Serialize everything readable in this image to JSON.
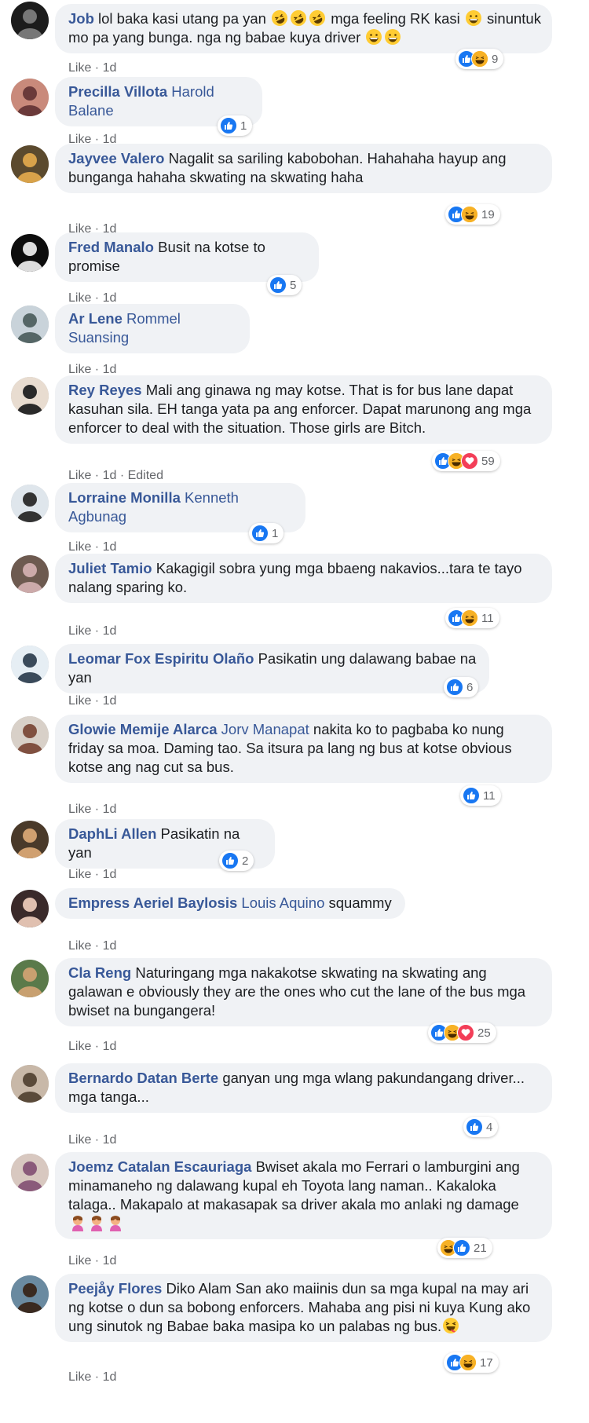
{
  "comments": [
    {
      "author": "Job",
      "mention": "",
      "text": "lol baka kasi utang pa yan",
      "emoji_after": [
        "rofl",
        "rofl",
        "rofl"
      ],
      "text2": " mga feeling RK kasi ",
      "emoji_after2": [
        "grin"
      ],
      "text3": " sinuntuk mo pa yang bunga. nga ng babae kuya driver ",
      "emoji_after3": [
        "smile",
        "grin"
      ],
      "like": "Like",
      "time": "1d",
      "edited": "",
      "reactions": [
        "like",
        "haha"
      ],
      "count": "9"
    },
    {
      "author": "Precilla Villota",
      "mention": "Harold Balane",
      "text": "",
      "like": "Like",
      "time": "1d",
      "edited": "",
      "reactions": [
        "like"
      ],
      "count": "1"
    },
    {
      "author": "Jayvee Valero",
      "mention": "",
      "text": "Nagalit sa sariling kabobohan. Hahahaha hayup ang bunganga hahaha skwating na skwating haha",
      "like": "Like",
      "time": "1d",
      "edited": "",
      "reactions": [
        "like",
        "haha"
      ],
      "count": "19"
    },
    {
      "author": "Fred Manalo",
      "mention": "",
      "text": "Busit na kotse to promise",
      "like": "Like",
      "time": "1d",
      "edited": "",
      "reactions": [
        "like"
      ],
      "count": "5"
    },
    {
      "author": "Ar Lene",
      "mention": "Rommel Suansing",
      "text": "",
      "like": "Like",
      "time": "1d",
      "edited": "",
      "reactions": [],
      "count": ""
    },
    {
      "author": "Rey Reyes",
      "mention": "",
      "text": "Mali ang ginawa ng may kotse. That is for bus lane dapat kasuhan sila. EH tanga yata pa ang enforcer. Dapat marunong ang mga enforcer to deal with the situation. Those girls are Bitch.",
      "like": "Like",
      "time": "1d",
      "edited": "Edited",
      "reactions": [
        "like",
        "haha",
        "love"
      ],
      "count": "59"
    },
    {
      "author": "Lorraine Monilla",
      "mention": "Kenneth Agbunag",
      "text": "",
      "like": "Like",
      "time": "1d",
      "edited": "",
      "reactions": [
        "like"
      ],
      "count": "1"
    },
    {
      "author": "Juliet Tamio",
      "mention": "",
      "text": "Kakagigil sobra yung mga bbaeng nakavios...tara te tayo nalang sparing ko.",
      "like": "Like",
      "time": "1d",
      "edited": "",
      "reactions": [
        "like",
        "haha"
      ],
      "count": "11"
    },
    {
      "author": "Leomar Fox Espiritu Olaño",
      "mention": "",
      "text": "Pasikatin ung dalawang babae na yan",
      "like": "Like",
      "time": "1d",
      "edited": "",
      "reactions": [
        "like"
      ],
      "count": "6"
    },
    {
      "author": "Glowie Memije Alarca",
      "mention": "Jorv Manapat",
      "text": "nakita ko to pagbaba ko nung friday sa moa. Daming tao. Sa itsura pa lang ng bus at kotse obvious kotse ang nag cut sa bus.",
      "like": "Like",
      "time": "1d",
      "edited": "",
      "reactions": [
        "like"
      ],
      "count": "11"
    },
    {
      "author": "DaphLi Allen",
      "mention": "",
      "text": "Pasikatin na yan",
      "like": "Like",
      "time": "1d",
      "edited": "",
      "reactions": [
        "like"
      ],
      "count": "2"
    },
    {
      "author": "Empress Aeriel Baylosis",
      "mention": "Louis Aquino",
      "text": "squammy",
      "like": "Like",
      "time": "1d",
      "edited": "",
      "reactions": [],
      "count": ""
    },
    {
      "author": "Cla Reng",
      "mention": "",
      "text": "Naturingang mga nakakotse skwating na skwating ang galawan e obviously they are the ones who cut the lane of the bus mga bwiset na bungangera!",
      "like": "Like",
      "time": "1d",
      "edited": "",
      "reactions": [
        "like",
        "haha",
        "love"
      ],
      "count": "25"
    },
    {
      "author": "Bernardo Datan Berte",
      "mention": "",
      "text": "ganyan ung mga wlang pakundangang driver... mga tanga...",
      "like": "Like",
      "time": "1d",
      "edited": "",
      "reactions": [
        "like"
      ],
      "count": "4"
    },
    {
      "author": "Joemz Catalan Escauriaga",
      "mention": "",
      "text": "Bwiset akala mo Ferrari o lamburgini ang minamaneho ng dalawang kupal eh Toyota lang naman.. Kakaloka talaga.. Makapalo at makasapak sa driver akala mo anlaki ng damage",
      "emoji_line": [
        "facepalm",
        "facepalm",
        "facepalm"
      ],
      "like": "Like",
      "time": "1d",
      "edited": "",
      "reactions": [
        "haha",
        "like"
      ],
      "count": "21"
    },
    {
      "author": "Peejåy Flores",
      "mention": "",
      "text": "Diko Alam San ako maiinis dun sa mga kupal na may ari ng kotse o dun sa bobong enforcers. Mahaba ang pisi ni kuya Kung ako ung sinutok ng Babae baka masipa ko un palabas ng bus.",
      "emoji_after": [
        "squint"
      ],
      "like": "Like",
      "time": "1d",
      "edited": "",
      "reactions": [
        "like",
        "haha"
      ],
      "count": "17"
    }
  ],
  "colors": {
    "link": "#385898",
    "bubble": "#f0f2f5",
    "like": "#1877f2",
    "haha": "#f7b125",
    "love": "#f33e58"
  }
}
